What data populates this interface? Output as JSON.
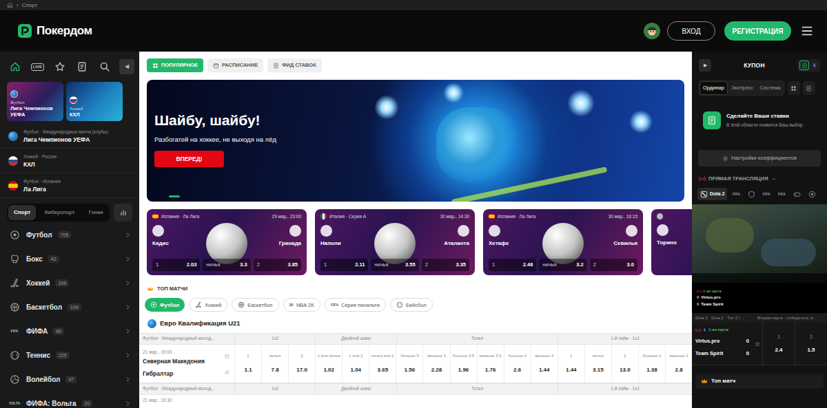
{
  "breadcrumb": {
    "separator": "›",
    "current": "Спорт"
  },
  "header": {
    "logo": "Покердом",
    "login": "ВХОД",
    "register": "РЕГИСТРАЦИЯ"
  },
  "left": {
    "nav": [
      {
        "kind": "home",
        "selected": true
      },
      {
        "kind": "live",
        "text": "LIVE",
        "selected": false
      },
      {
        "kind": "star",
        "selected": false
      },
      {
        "kind": "doc",
        "selected": false
      },
      {
        "kind": "search",
        "selected": false
      }
    ],
    "collapse": "◀",
    "featured": [
      {
        "sport": "Футбол",
        "league": "Лига Чемпионов УЕФА",
        "kind": "world"
      },
      {
        "sport": "Хоккей",
        "league": "КХЛ",
        "kind": "russia"
      }
    ],
    "recent": [
      {
        "path": "Футбол · Международные матчи (клубы)",
        "league": "Лига Чемпионов УЕФА",
        "kind": "world"
      },
      {
        "path": "Хоккей · Россия",
        "league": "КХЛ",
        "kind": "russia"
      },
      {
        "path": "Футбол · Испания",
        "league": "Ла Лига",
        "kind": "spain"
      }
    ],
    "tabs": [
      {
        "label": "Спорт",
        "selected": true
      },
      {
        "label": "Киберспорт",
        "selected": false
      },
      {
        "label": "Гонки",
        "selected": false
      }
    ],
    "sports": [
      {
        "label": "Футбол",
        "count": "705",
        "kind": "football"
      },
      {
        "label": "Бокс",
        "count": "42",
        "kind": "boxing"
      },
      {
        "label": "Хоккей",
        "count": "106",
        "kind": "hockey"
      },
      {
        "label": "Баскетбол",
        "count": "109",
        "kind": "basketball"
      },
      {
        "label": "ФИФА",
        "count": "86",
        "kind": "text",
        "icon_text": "FIFA"
      },
      {
        "label": "Теннис",
        "count": "225",
        "kind": "tennis"
      },
      {
        "label": "Волейбол",
        "count": "47",
        "kind": "volleyball"
      },
      {
        "label": "ФИФА: Вольта",
        "count": "20",
        "kind": "text",
        "icon_text": "VOLTA"
      }
    ]
  },
  "center": {
    "feed_tabs": [
      {
        "label": "ПОПУЛЯРНОЕ",
        "kind": "grid",
        "selected": true
      },
      {
        "label": "РАСПИСАНИЕ",
        "kind": "calendar",
        "selected": false
      },
      {
        "label": "ФИД СТАВОК",
        "kind": "doc",
        "selected": false
      }
    ],
    "banner": {
      "title": "Шайбу, шайбу!",
      "subtitle": "Разбогатей на хоккее, не выходя на лёд",
      "button": "ВПЕРЕД!",
      "slides": [
        {
          "selected": true
        }
      ]
    },
    "featured_matches": [
      {
        "kind": "spain",
        "league": "Испания · Ла Лига",
        "date": "29 мар., 23:00",
        "home": "Кадис",
        "away": "Гранада",
        "odds": [
          {
            "label": "1",
            "value": "2.03"
          },
          {
            "label": "ничья",
            "value": "3.3"
          },
          {
            "label": "2",
            "value": "3.85"
          }
        ]
      },
      {
        "kind": "italy",
        "league": "Италия · Серия А",
        "date": "30 мар., 14:30",
        "home": "Наполи",
        "away": "Аталанта",
        "odds": [
          {
            "label": "1",
            "value": "2.11"
          },
          {
            "label": "ничья",
            "value": "3.55"
          },
          {
            "label": "2",
            "value": "3.35"
          }
        ]
      },
      {
        "kind": "spain",
        "league": "Испания · Ла Лига",
        "date": "30 мар., 16:15",
        "home": "Хетафе",
        "away": "Севилья",
        "odds": [
          {
            "label": "1",
            "value": "2.46"
          },
          {
            "label": "ничья",
            "value": "3.2"
          },
          {
            "label": "2",
            "value": "3.0"
          }
        ]
      },
      {
        "home": "Торино"
      }
    ],
    "top_matches": {
      "title": "ТОП МАТЧИ",
      "filters": [
        {
          "label": "Футбол",
          "kind": "football",
          "selected": true
        },
        {
          "label": "Хоккей",
          "kind": "hockey",
          "selected": false
        },
        {
          "label": "Баскетбол",
          "kind": "basketball",
          "selected": false
        },
        {
          "label": "NBA 2K",
          "kind": "text",
          "icon_text": "2K",
          "selected": false
        },
        {
          "label": "Серия пенальти",
          "kind": "text",
          "icon_text": "FIFA",
          "selected": false
        },
        {
          "label": "Бейсбол",
          "kind": "baseball",
          "selected": false
        }
      ]
    },
    "league": "Евро Квалификация U21",
    "table": {
      "groups": [
        {
          "label": "1x2",
          "outcomes": [
            "1",
            "ничья",
            "2"
          ]
        },
        {
          "label": "Двойной шанс",
          "outcomes": [
            "1 или ничья",
            "1 или 2",
            "ничья или 2"
          ]
        },
        {
          "label": "Тотал",
          "outcomes": [
            "больше 3",
            "меньше 3",
            "больше 3.5",
            "меньше 3.5",
            "больше 4",
            "меньше 4"
          ]
        },
        {
          "label": "1-й тайм - 1x2",
          "outcomes": [
            "1",
            "ничья",
            "2",
            "больше 1",
            "меньше 1"
          ]
        }
      ],
      "matches": [
        {
          "category": "Футбол · Международный молод…",
          "date": "21 мар., 16:00",
          "home": "Северная Македония",
          "away": "Гибралтар",
          "odds": [
            [
              "1.1",
              "7.8",
              "17.0"
            ],
            [
              "1.02",
              "1.04",
              "3.65"
            ],
            [
              "1.56",
              "2.28",
              "1.96",
              "1.76",
              "2.6",
              "1.44"
            ],
            [
              "1.44",
              "3.15",
              "13.0",
              "1.38",
              "2.8"
            ]
          ]
        },
        {
          "category": "Футбол · Международный молод…",
          "date": "21 мар., 19:30"
        }
      ]
    }
  },
  "coupon": {
    "expand": "▶",
    "title": "КУПОН",
    "tabs": [
      {
        "label": "Ординар",
        "selected": true
      },
      {
        "label": "Экспресс",
        "selected": false
      },
      {
        "label": "Система",
        "selected": false
      }
    ],
    "empty_title": "Сделайте Ваши ставки",
    "empty_text": "В этой области появится Ваш выбор",
    "settings": "Настройки коэффициентов"
  },
  "live": {
    "title": "ПРЯМАЯ ТРАНСЛЯЦИЯ",
    "games": [
      {
        "kind": "dota",
        "label": "Dota 2",
        "selected": true
      },
      {
        "kind": "text",
        "icon_text": "FIFA",
        "selected": false
      },
      {
        "kind": "shield",
        "selected": false
      },
      {
        "kind": "text",
        "icon_text": "FIFA",
        "selected": false
      },
      {
        "kind": "text",
        "icon_text": "FIFA",
        "selected": false
      },
      {
        "kind": "pad",
        "selected": false
      },
      {
        "kind": "ball",
        "selected": false
      }
    ],
    "overlay": {
      "map": "1-ая карта",
      "teams": [
        {
          "score": "0",
          "name": "Virtus.pro"
        },
        {
          "score": "0",
          "name": "Team Spirit"
        }
      ]
    },
    "event": {
      "path": "Dota 2 · Dota 2 · Tier-2 I…",
      "market": "Вторая карта - победитель (к…",
      "period": "1-ая карта",
      "teams": [
        {
          "name": "Virtus.pro",
          "score": "0"
        },
        {
          "name": "Team Spirit",
          "score": "0"
        }
      ],
      "odds": [
        {
          "label": "1",
          "value": "2.4"
        },
        {
          "label": "2",
          "value": "1.5"
        }
      ]
    }
  },
  "top_match": "Топ матч"
}
